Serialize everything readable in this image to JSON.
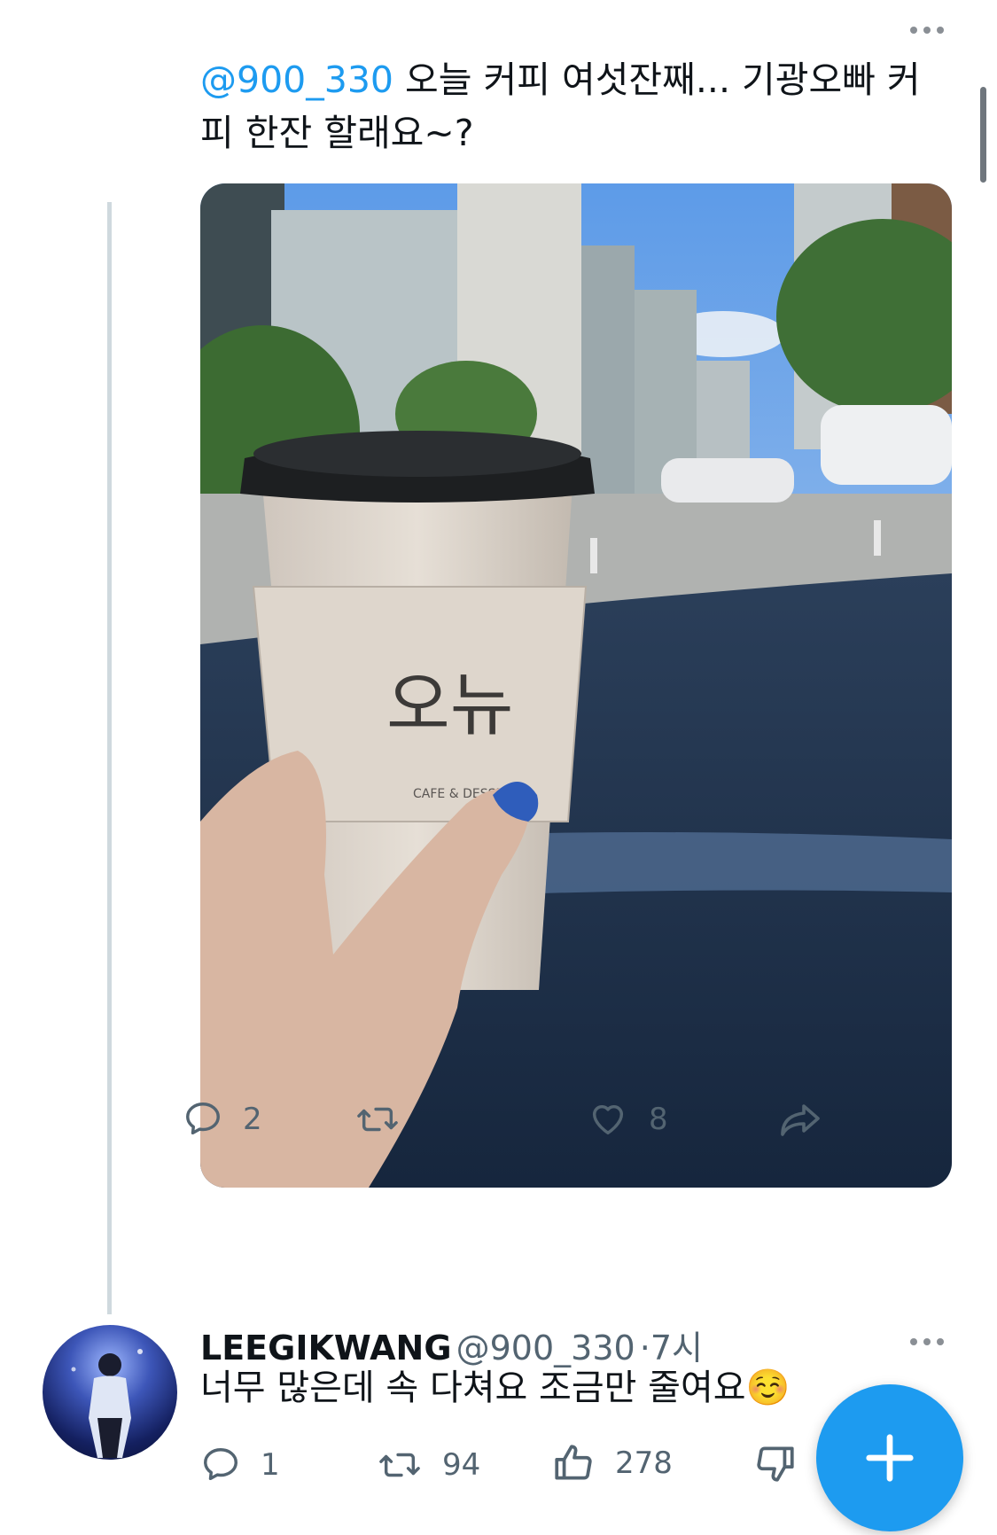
{
  "tweet": {
    "mention": "@900_330",
    "text": " 오늘 커피 여섯잔째... 기광오빠 커피 한잔 할래요~?",
    "photo": {
      "cup_logo": "오뉴",
      "cup_sub": "CAFE & DESSERT"
    },
    "actions": {
      "reply_count": "2",
      "retweet_count": "",
      "like_count": "8"
    }
  },
  "reply": {
    "display_name": "LEEGIKWANG",
    "handle": "@900_330",
    "separator": "·",
    "time": "7시",
    "text": "너무 많은데 속 다쳐요 조금만 줄여요",
    "emoji": "☺️",
    "actions": {
      "reply_count": "1",
      "retweet_count": "94",
      "like_count": "278"
    }
  },
  "icons": {
    "more": "more-horizontal-icon",
    "reply": "reply-bubble-icon",
    "retweet": "retweet-icon",
    "like": "heart-icon",
    "share": "share-icon",
    "upvote": "thumbs-up-icon",
    "downvote": "thumbs-down-icon",
    "compose": "plus-icon"
  },
  "colors": {
    "accent": "#1d9bf0",
    "muted": "#536471",
    "text": "#0f1419"
  }
}
